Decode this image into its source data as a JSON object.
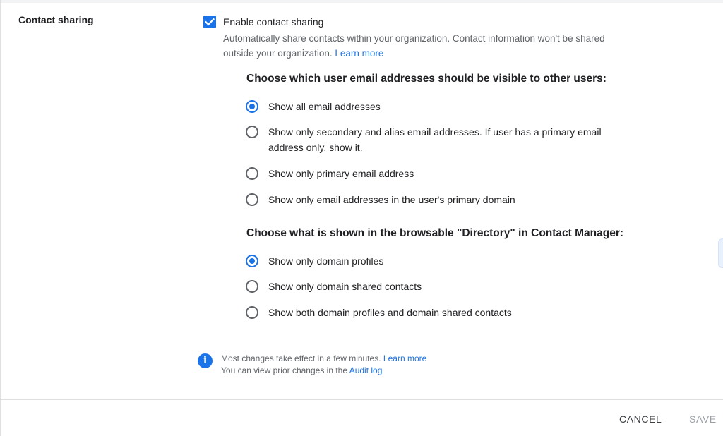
{
  "section": {
    "label": "Contact sharing"
  },
  "enable_sharing": {
    "checked": true,
    "label": "Enable contact sharing",
    "description": "Automatically share contacts within your organization. Contact information won't be shared outside your organization.",
    "learn_more": "Learn more"
  },
  "email_visibility": {
    "heading": "Choose which user email addresses should be visible to other users:",
    "selected_index": 0,
    "options": [
      {
        "label": "Show all email addresses"
      },
      {
        "label": "Show only secondary and alias email addresses. If user has a primary email address only, show it."
      },
      {
        "label": "Show only primary email address"
      },
      {
        "label": "Show only email addresses in the user's primary domain"
      }
    ]
  },
  "directory": {
    "heading": "Choose what is shown in the browsable \"Directory\" in Contact Manager:",
    "selected_index": 0,
    "options": [
      {
        "label": "Show only domain profiles"
      },
      {
        "label": "Show only domain shared contacts"
      },
      {
        "label": "Show both domain profiles and domain shared contacts"
      }
    ]
  },
  "info": {
    "icon": "info-icon",
    "line1": "Most changes take effect in a few minutes.",
    "line1_link": "Learn more",
    "line2": "You can view prior changes in the",
    "line2_link": "Audit log"
  },
  "footer": {
    "cancel_label": "CANCEL",
    "save_label": "SAVE"
  },
  "colors": {
    "accent": "#1a73e8",
    "text": "#202124",
    "secondary_text": "#5f6368",
    "disabled": "#9aa0a6"
  }
}
